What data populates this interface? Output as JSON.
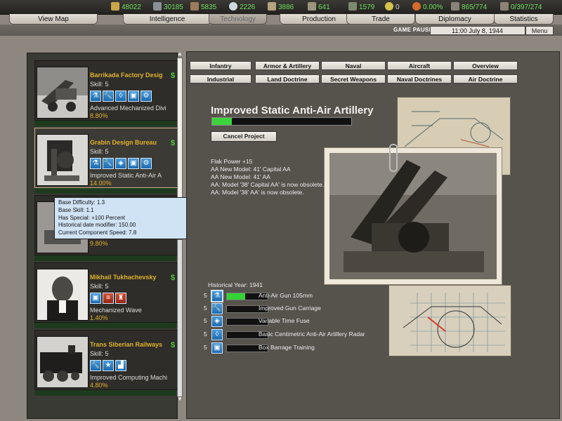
{
  "resources": [
    {
      "icon": "energy-icon",
      "value": "48022",
      "color": "#6fe05d"
    },
    {
      "icon": "metal-icon",
      "value": "30185",
      "color": "#6fe05d"
    },
    {
      "icon": "rare-materials-icon",
      "value": "5835",
      "color": "#6fe05d"
    },
    {
      "icon": "oil-icon",
      "value": "2226",
      "color": "#6fe05d"
    },
    {
      "icon": "supplies-icon",
      "value": "3886",
      "color": "#6fe05d"
    },
    {
      "icon": "money-icon",
      "value": "641",
      "color": "#6fe05d"
    },
    {
      "icon": "manpower-icon",
      "value": "1579",
      "color": "#6fe05d"
    },
    {
      "icon": "nuclear-icon",
      "value": "0",
      "color": "#dddddd"
    },
    {
      "icon": "dissent-icon",
      "value": "0.00%",
      "color": "#6fe05d"
    },
    {
      "icon": "ic-icon",
      "value": "865/774",
      "color": "#6fe05d"
    },
    {
      "icon": "transport-icon",
      "value": "0/397/274",
      "color": "#6fe05d"
    }
  ],
  "tabs": [
    {
      "label": "View Map",
      "active": false
    },
    {
      "label": "Intelligence",
      "active": false
    },
    {
      "label": "Technology",
      "active": true
    },
    {
      "label": "Production",
      "active": false
    },
    {
      "label": "Trade",
      "active": false
    },
    {
      "label": "Diplomacy",
      "active": false
    },
    {
      "label": "Statistics",
      "active": false
    }
  ],
  "status": {
    "paused": "GAME PAUSED",
    "date": "11:00 July 8, 1944",
    "menu": "Menu"
  },
  "teams": [
    {
      "name": "Barrikada Factory Desig",
      "skill": "Skill: 5",
      "project": "Advanced Mechanized Divi",
      "percent": "8.80%",
      "icons": [
        "research-icon",
        "wrench-icon",
        "bulb-icon",
        "manual-icon",
        "gear-icon"
      ]
    },
    {
      "name": "Grabin Design Bureau",
      "skill": "Skill: 5",
      "project": "Improved Static Anti-Air A",
      "percent": "14.00%",
      "icons": [
        "research-icon",
        "wrench-icon",
        "flask-icon",
        "manual-icon",
        "gear-icon"
      ]
    },
    {
      "name": "",
      "skill": "",
      "project": "",
      "percent": "9.80%",
      "icons": []
    },
    {
      "name": "Mikhail Tukhachevsky",
      "skill": "Skill: 5",
      "project": "Mechanized Wave",
      "percent": "1.40%",
      "icons": [
        "manual-icon",
        "artillery-icon",
        "infantry-icon"
      ]
    },
    {
      "name": "Trans Siberian Railways",
      "skill": "Skill: 5",
      "project": "Improved Computing Machi",
      "percent": "4.80%",
      "icons": [
        "wrench-icon",
        "star-icon",
        "factory-icon"
      ]
    }
  ],
  "tooltip": {
    "lines": [
      "Base Difficulty: 1.3",
      "Base Skill: 1.1",
      "Has Special: +100 Percent",
      "Historical date modifier: 150.00",
      "Current Component Speed: 7.8"
    ]
  },
  "categories": {
    "row1": [
      "Infantry",
      "Armor & Artillery",
      "Naval",
      "Aircraft",
      "Overview"
    ],
    "row2": [
      "Industrial",
      "Land Doctrine",
      "Secret Weapons",
      "Naval Doctrines",
      "Air Doctrine"
    ]
  },
  "project": {
    "title": "Improved Static Anti-Air Artillery",
    "progress_percent": 14,
    "cancel_label": "Cancel Project",
    "effects": [
      "Flak Power +15",
      "AA New Model: 41' Capital AA",
      "AA New Model: 41' AA",
      "AA: Model '38' Capital AA' is now obsolete.",
      "AA: Model '38' AA' is now obsolete."
    ],
    "historical_year": "Historical Year: 1941",
    "components": [
      {
        "level": "5",
        "icon": "research-icon",
        "name": "Anti-Air Gun 105mm",
        "progress": 0.45
      },
      {
        "level": "5",
        "icon": "wrench-icon",
        "name": "Improved Gun Carriage",
        "progress": 0
      },
      {
        "level": "5",
        "icon": "flask-icon",
        "name": "Variable Time Fuse",
        "progress": 0
      },
      {
        "level": "5",
        "icon": "bulb-icon",
        "name": "Basic Centimetric Anti-Air Artillery Radar",
        "progress": 0
      },
      {
        "level": "5",
        "icon": "manual-icon",
        "name": "Box Barrage Training",
        "progress": 0
      }
    ]
  }
}
